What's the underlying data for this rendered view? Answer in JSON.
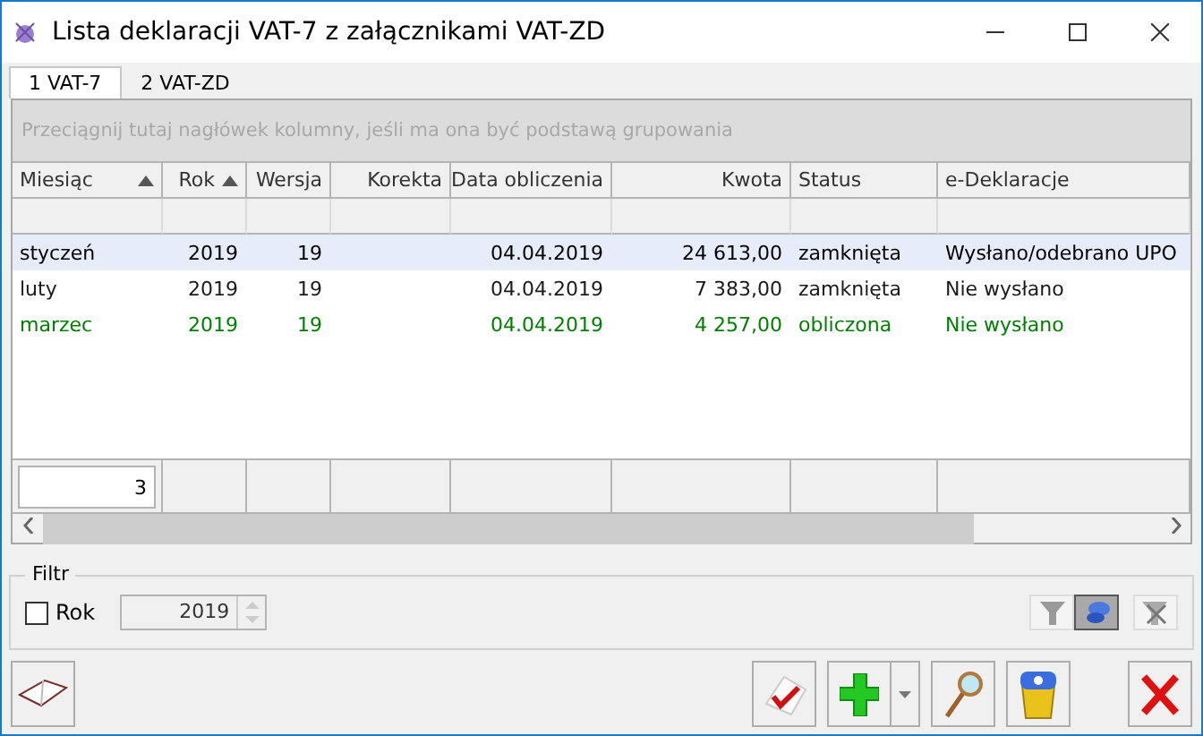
{
  "window": {
    "title": "Lista deklaracji VAT-7 z załącznikami VAT-ZD"
  },
  "tabs": [
    {
      "label": "1 VAT-7",
      "selected": true
    },
    {
      "label": "2 VAT-ZD",
      "selected": false
    }
  ],
  "grid": {
    "group_hint": "Przeciągnij tutaj nagłówek kolumny, jeśli ma ona być podstawą grupowania",
    "columns": [
      {
        "label": "Miesiąc",
        "sorted": true
      },
      {
        "label": "Rok",
        "sorted": true
      },
      {
        "label": "Wersja",
        "sorted": false
      },
      {
        "label": "Korekta",
        "sorted": false
      },
      {
        "label": "Data obliczenia",
        "sorted": false
      },
      {
        "label": "Kwota",
        "sorted": false
      },
      {
        "label": "Status",
        "sorted": false
      },
      {
        "label": "e-Deklaracje",
        "sorted": false
      }
    ],
    "rows": [
      {
        "selected": true,
        "color": "#000000",
        "cells": [
          "styczeń",
          "2019",
          "19",
          "",
          "04.04.2019",
          "24 613,00",
          "zamknięta",
          "Wysłano/odebrano UPO"
        ]
      },
      {
        "selected": false,
        "color": "#1a1a1a",
        "cells": [
          "luty",
          "2019",
          "19",
          "",
          "04.04.2019",
          "7 383,00",
          "zamknięta",
          "Nie wysłano"
        ]
      },
      {
        "selected": false,
        "color": "#008000",
        "cells": [
          "marzec",
          "2019",
          "19",
          "",
          "04.04.2019",
          "4 257,00",
          "obliczona",
          "Nie wysłano"
        ]
      }
    ],
    "count": "3"
  },
  "filter": {
    "title": "Filtr",
    "year_label": "Rok",
    "year_checked": false,
    "year_value": "2019",
    "tools": [
      {
        "kind": "funnel",
        "pressed": false
      },
      {
        "kind": "pin",
        "pressed": true
      },
      {
        "kind": "clear",
        "pressed": false
      }
    ]
  }
}
